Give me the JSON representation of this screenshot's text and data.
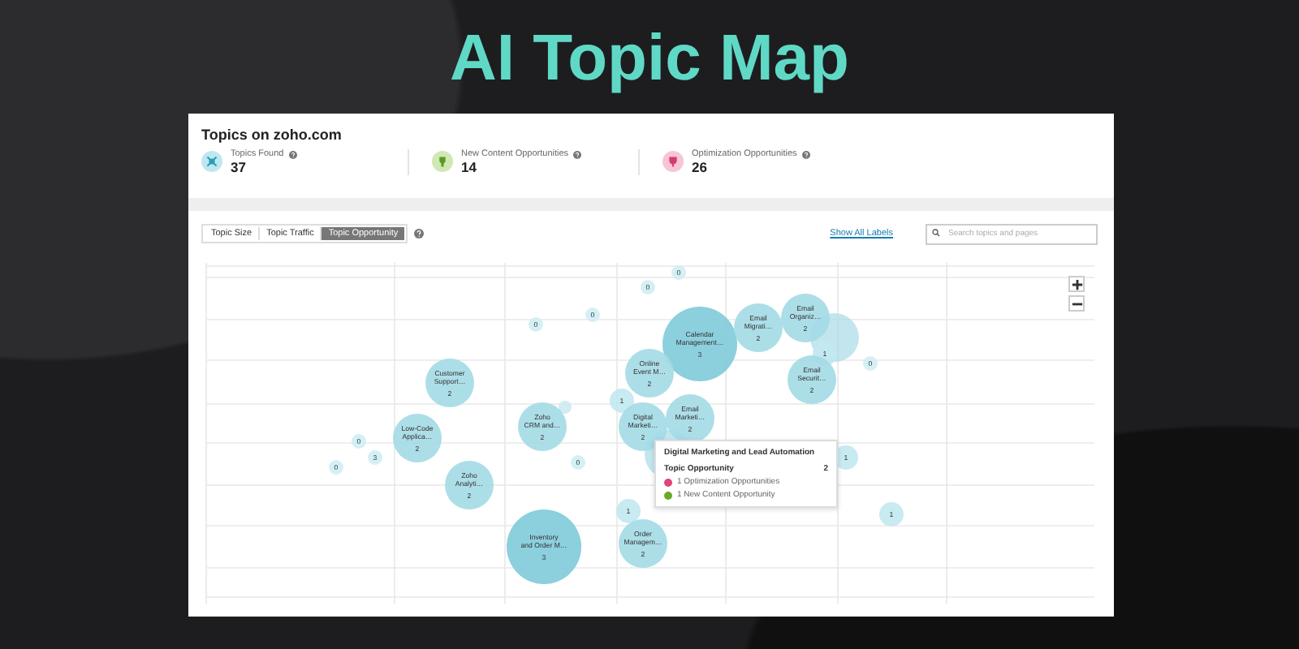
{
  "title": "AI Topic Map",
  "panel": {
    "title": "Topics on zoho.com",
    "stats": [
      {
        "kind": "topics",
        "label": "Topics Found",
        "value": "37"
      },
      {
        "kind": "new",
        "label": "New Content Opportunities",
        "value": "14"
      },
      {
        "kind": "optimization",
        "label": "Optimization Opportunities",
        "value": "26"
      }
    ]
  },
  "toolbar": {
    "views": [
      {
        "label": "Topic Size",
        "selected": false
      },
      {
        "label": "Topic Traffic",
        "selected": false
      },
      {
        "label": "Topic Opportunity",
        "selected": true
      }
    ],
    "show_labels_link": "Show All Labels",
    "search": {
      "placeholder": "Search topics and pages"
    }
  },
  "map": {
    "bubbles": [
      {
        "kind": "tiny",
        "count": "0"
      },
      {
        "kind": "tiny",
        "count": "0"
      },
      {
        "kind": "tiny",
        "count": "0"
      },
      {
        "kind": "tiny",
        "count": "0"
      },
      {
        "kind": "large",
        "label_lines": [
          "Calendar",
          "Management…"
        ],
        "count": "3"
      },
      {
        "kind": "medium",
        "label_lines": [
          "Email",
          "Migrati…"
        ],
        "count": "2"
      },
      {
        "kind": "medium",
        "label_lines": [
          "Email",
          "Organiz…"
        ],
        "count": "2"
      },
      {
        "kind": "small",
        "count": "1"
      },
      {
        "kind": "blank"
      },
      {
        "kind": "medium",
        "label_lines": [
          "Customer",
          "Support…"
        ],
        "count": "2"
      },
      {
        "kind": "dot"
      },
      {
        "kind": "small",
        "count": "1"
      },
      {
        "kind": "medium",
        "label_lines": [
          "Online",
          "Event M…"
        ],
        "count": "2"
      },
      {
        "kind": "medium",
        "label_lines": [
          "Email",
          "Securit…"
        ],
        "count": "2"
      },
      {
        "kind": "tiny",
        "count": "0"
      },
      {
        "kind": "tiny",
        "count": "0"
      },
      {
        "kind": "tiny",
        "count": "0"
      },
      {
        "kind": "tiny",
        "count": "3"
      },
      {
        "kind": "medium",
        "label_lines": [
          "Low-Code",
          "Applica…"
        ],
        "count": "2"
      },
      {
        "kind": "medium",
        "label_lines": [
          "Zoho",
          "Analyti…"
        ],
        "count": "2"
      },
      {
        "kind": "medium",
        "label_lines": [
          "Zoho",
          "CRM and…"
        ],
        "count": "2"
      },
      {
        "kind": "tiny",
        "count": "0"
      },
      {
        "kind": "medium",
        "label_lines": [
          "Digital",
          "Marketi…"
        ],
        "count": "2"
      },
      {
        "kind": "blank"
      },
      {
        "kind": "medium",
        "label_lines": [
          "Email",
          "Marketi…"
        ],
        "count": "2"
      },
      {
        "kind": "small",
        "count": "1"
      },
      {
        "kind": "large",
        "label_lines": [
          "Inventory",
          "and Order M…"
        ],
        "count": "3"
      },
      {
        "kind": "small",
        "count": "1"
      },
      {
        "kind": "medium",
        "label_lines": [
          "Order",
          "Managem…"
        ],
        "count": "2"
      },
      {
        "kind": "small",
        "count": "1"
      }
    ],
    "tooltip": {
      "title": "Digital Marketing and Lead Automation",
      "metric": "Topic Opportunity",
      "metric_value": "2",
      "items": [
        {
          "text": "1 Optimization Opportunities",
          "color": "#e0457b"
        },
        {
          "text": "1 New Content Opportunity",
          "color": "#6aaa2a"
        }
      ]
    }
  }
}
